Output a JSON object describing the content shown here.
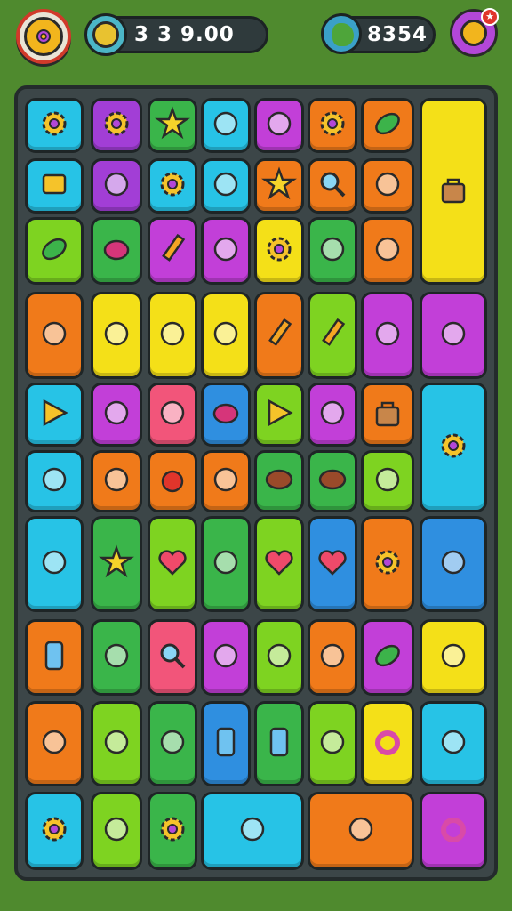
{
  "hud": {
    "coins": {
      "value": "3  3 9.00",
      "icon": "coin-icon"
    },
    "gems": {
      "value": "8354",
      "icon": "globe-icon"
    },
    "settings": {
      "icon": "gear-icon"
    },
    "reward": {
      "icon": "reward-coin-icon",
      "badge_icon": "star-icon"
    }
  },
  "colors": {
    "background": "#4f8a2e",
    "board": "#3c4648",
    "cyan": "#27c3e6",
    "purple": "#a23ed6",
    "green": "#3ab54a",
    "orange": "#f07a1a",
    "yellow": "#f4e018",
    "lime": "#7ed321",
    "pink": "#f2557a",
    "blue": "#2f8fe0",
    "magenta": "#c23fd8"
  },
  "board": {
    "columns": 8,
    "rows": 8,
    "tiles": [
      {
        "id": "r1c1",
        "color": "cyan",
        "icon": "gear-icon"
      },
      {
        "id": "r1c2",
        "color": "purple",
        "icon": "gear-icon"
      },
      {
        "id": "r1c3",
        "color": "green",
        "icon": "star-icon"
      },
      {
        "id": "r1c4",
        "color": "cyan",
        "icon": "branch-icon"
      },
      {
        "id": "r1c5",
        "color": "magenta",
        "icon": "pizza-icon"
      },
      {
        "id": "r1c6",
        "color": "orange",
        "icon": "gear-icon"
      },
      {
        "id": "r1c7",
        "color": "orange",
        "icon": "leaf-icon"
      },
      {
        "id": "r1c8",
        "color": "yellow",
        "icon": "creature-icon"
      },
      {
        "id": "r2c1",
        "color": "cyan",
        "icon": "box-icon"
      },
      {
        "id": "r2c2",
        "color": "purple",
        "icon": "bird-icon"
      },
      {
        "id": "r2c3",
        "color": "cyan",
        "icon": "gear-icon"
      },
      {
        "id": "r2c4",
        "color": "cyan",
        "icon": "horn-icon"
      },
      {
        "id": "r2c5",
        "color": "orange",
        "icon": "star-icon"
      },
      {
        "id": "r2c6",
        "color": "orange",
        "icon": "magnifier-icon"
      },
      {
        "id": "r2c7",
        "color": "orange",
        "icon": "fish-icon"
      },
      {
        "id": "r2c8",
        "color": "yellow",
        "icon": "bag-icon"
      },
      {
        "id": "r3c1",
        "color": "lime",
        "icon": "leaf-icon"
      },
      {
        "id": "r3c2",
        "color": "green",
        "icon": "fruit-icon"
      },
      {
        "id": "r3c3",
        "color": "magenta",
        "icon": "pencil-icon"
      },
      {
        "id": "r3c4",
        "color": "magenta",
        "icon": "tube-icon"
      },
      {
        "id": "r3c5",
        "color": "yellow",
        "icon": "gear-icon"
      },
      {
        "id": "r3c6",
        "color": "green",
        "icon": "flower-icon"
      },
      {
        "id": "r3c7",
        "color": "orange",
        "icon": "frame-icon"
      },
      {
        "id": "r4c1",
        "color": "orange",
        "icon": "ghost-icon"
      },
      {
        "id": "r4c2",
        "color": "yellow",
        "icon": "book-icon"
      },
      {
        "id": "r4c3",
        "color": "yellow",
        "icon": "face-icon"
      },
      {
        "id": "r4c4",
        "color": "yellow",
        "icon": "jar-icon"
      },
      {
        "id": "r4c5",
        "color": "orange",
        "icon": "pencil-icon"
      },
      {
        "id": "r4c6",
        "color": "lime",
        "icon": "pencil-icon"
      },
      {
        "id": "r4c7",
        "color": "magenta",
        "icon": "computer-icon"
      },
      {
        "id": "r4c8",
        "color": "magenta",
        "icon": "cheese-icon"
      },
      {
        "id": "r5c1",
        "color": "cyan",
        "icon": "play-icon"
      },
      {
        "id": "r5c2",
        "color": "magenta",
        "icon": "cookie-icon"
      },
      {
        "id": "r5c3",
        "color": "pink",
        "icon": "egg-icon"
      },
      {
        "id": "r5c4",
        "color": "blue",
        "icon": "fruit-icon"
      },
      {
        "id": "r5c5",
        "color": "lime",
        "icon": "play-icon"
      },
      {
        "id": "r5c6",
        "color": "magenta",
        "icon": "picture-icon"
      },
      {
        "id": "r5c7",
        "color": "orange",
        "icon": "bag-icon"
      },
      {
        "id": "r5c8",
        "color": "cyan",
        "icon": "gear-icon"
      },
      {
        "id": "r6c1",
        "color": "cyan",
        "icon": "ghost-icon"
      },
      {
        "id": "r6c2",
        "color": "orange",
        "icon": "dice-icon"
      },
      {
        "id": "r6c3",
        "color": "orange",
        "icon": "apple-icon"
      },
      {
        "id": "r6c4",
        "color": "orange",
        "icon": "card-icon"
      },
      {
        "id": "r6c5",
        "color": "green",
        "icon": "bean-icon"
      },
      {
        "id": "r6c6",
        "color": "green",
        "icon": "bean-icon"
      },
      {
        "id": "r6c7",
        "color": "lime",
        "icon": "block-icon"
      },
      {
        "id": "r7c1",
        "color": "cyan",
        "icon": "crate-icon"
      },
      {
        "id": "r7c2",
        "color": "green",
        "icon": "star-icon"
      },
      {
        "id": "r7c3",
        "color": "lime",
        "icon": "heart-icon"
      },
      {
        "id": "r7c4",
        "color": "green",
        "icon": "flower-icon"
      },
      {
        "id": "r7c5",
        "color": "lime",
        "icon": "heart-icon"
      },
      {
        "id": "r7c6",
        "color": "blue",
        "icon": "heart-icon"
      },
      {
        "id": "r7c7",
        "color": "orange",
        "icon": "gear-icon"
      },
      {
        "id": "r7c8",
        "color": "blue",
        "icon": "clock-icon"
      },
      {
        "id": "r8c1",
        "color": "orange",
        "icon": "phone-icon"
      },
      {
        "id": "r8c2",
        "color": "green",
        "icon": "bird-icon"
      },
      {
        "id": "r8c3",
        "color": "pink",
        "icon": "magnifier-icon"
      },
      {
        "id": "r8c4",
        "color": "magenta",
        "icon": "crystal-icon"
      },
      {
        "id": "r8c5",
        "color": "lime",
        "icon": "bird-icon"
      },
      {
        "id": "r8c6",
        "color": "orange",
        "icon": "pill-icon"
      },
      {
        "id": "r8c7",
        "color": "magenta",
        "icon": "leaf-icon"
      },
      {
        "id": "r8c8",
        "color": "yellow",
        "icon": "screen-icon"
      },
      {
        "id": "r9c1",
        "color": "orange",
        "icon": "tree-icon"
      },
      {
        "id": "r9c2",
        "color": "lime",
        "icon": "cup-icon"
      },
      {
        "id": "r9c3",
        "color": "green",
        "icon": "brush-icon"
      },
      {
        "id": "r9c4",
        "color": "blue",
        "icon": "phone-icon"
      },
      {
        "id": "r9c5",
        "color": "green",
        "icon": "phone-icon"
      },
      {
        "id": "r9c6",
        "color": "lime",
        "icon": "book-icon"
      },
      {
        "id": "r9c7",
        "color": "yellow",
        "icon": "ring-icon"
      },
      {
        "id": "r9c8",
        "color": "cyan",
        "icon": "robot-icon"
      },
      {
        "id": "r10c1",
        "color": "cyan",
        "icon": "gear-icon"
      },
      {
        "id": "r10c2",
        "color": "lime",
        "icon": "chair-icon"
      },
      {
        "id": "r10c3",
        "color": "green",
        "icon": "gear-icon"
      },
      {
        "id": "r10c4",
        "color": "cyan",
        "icon": "tray-icon"
      },
      {
        "id": "r10c5",
        "color": "orange",
        "icon": "tree-icon"
      },
      {
        "id": "r10c6",
        "color": "magenta",
        "icon": "ring-icon"
      }
    ]
  }
}
